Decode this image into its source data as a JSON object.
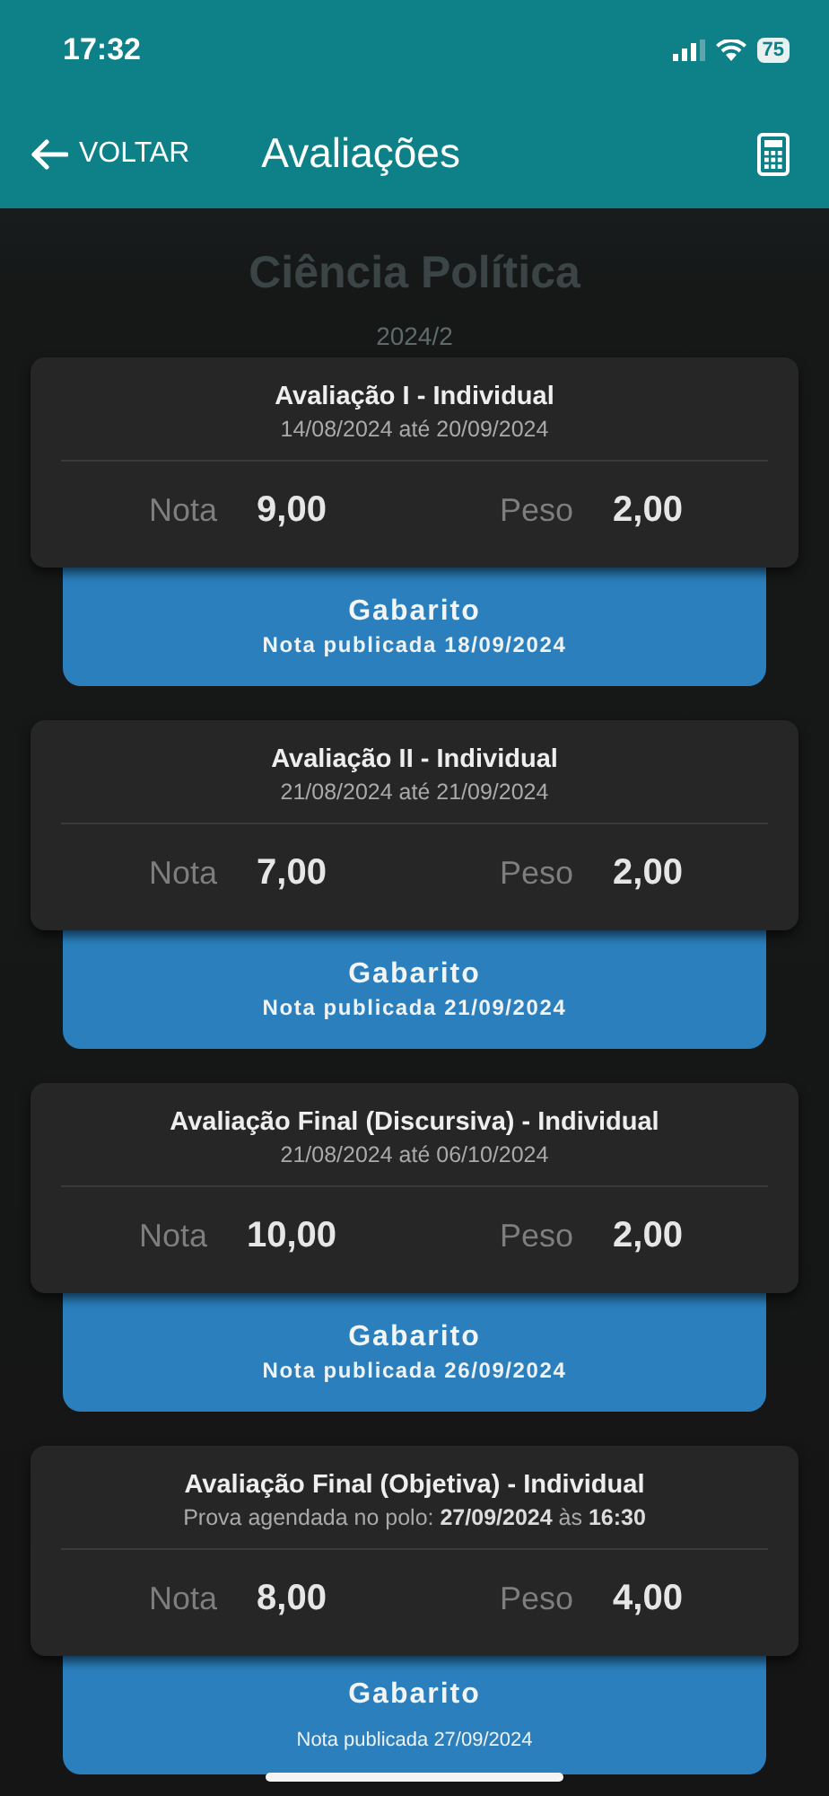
{
  "status_bar": {
    "time": "17:32",
    "battery": "75"
  },
  "header": {
    "back": "VOLTAR",
    "title": "Avaliações"
  },
  "subject": {
    "name": "Ciência Política",
    "term": "2024/2"
  },
  "assessments": [
    {
      "title": "Avaliação I - Individual",
      "period": "14/08/2024 até 20/09/2024",
      "grade_label": "Nota",
      "grade": "9,00",
      "weight_label": "Peso",
      "weight": "2,00",
      "button": "Gabarito",
      "note": "Nota publicada 18/09/2024",
      "note_bold": true
    },
    {
      "title": "Avaliação II - Individual",
      "period": "21/08/2024 até 21/09/2024",
      "grade_label": "Nota",
      "grade": "7,00",
      "weight_label": "Peso",
      "weight": "2,00",
      "button": "Gabarito",
      "note": "Nota publicada 21/09/2024",
      "note_bold": true
    },
    {
      "title": "Avaliação Final (Discursiva) - Individual",
      "period": "21/08/2024 até 06/10/2024",
      "grade_label": "Nota",
      "grade": "10,00",
      "weight_label": "Peso",
      "weight": "2,00",
      "button": "Gabarito",
      "note": "Nota publicada 26/09/2024",
      "note_bold": true
    },
    {
      "title": "Avaliação Final (Objetiva) - Individual",
      "period": "Prova agendada no polo: **27/09/2024** às **16:30**",
      "grade_label": "Nota",
      "grade": "8,00",
      "weight_label": "Peso",
      "weight": "4,00",
      "button": "Gabarito",
      "note": "Nota publicada 27/09/2024",
      "note_bold": false
    }
  ]
}
